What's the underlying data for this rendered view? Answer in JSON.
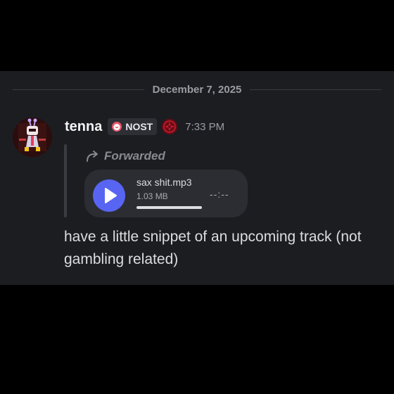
{
  "date_divider": "December 7, 2025",
  "message": {
    "author": "tenna",
    "server_tag": "NOST",
    "timestamp": "7:33 PM",
    "forwarded_label": "Forwarded",
    "attachment": {
      "filename": "sax shit.mp3",
      "size": "1.03 MB",
      "duration": "--:--",
      "progress_fraction": 1.0
    },
    "content": "have a little snippet of an upcoming track (not gambling related)"
  },
  "colors": {
    "accent": "#5865f2",
    "background": "#1c1d21",
    "outer": "#000000"
  },
  "icons": {
    "tag_icon": "smile-heart-icon",
    "role_icon": "spiral-emblem-icon",
    "forward_icon": "forward-arrow-icon",
    "play_icon": "play-icon"
  }
}
